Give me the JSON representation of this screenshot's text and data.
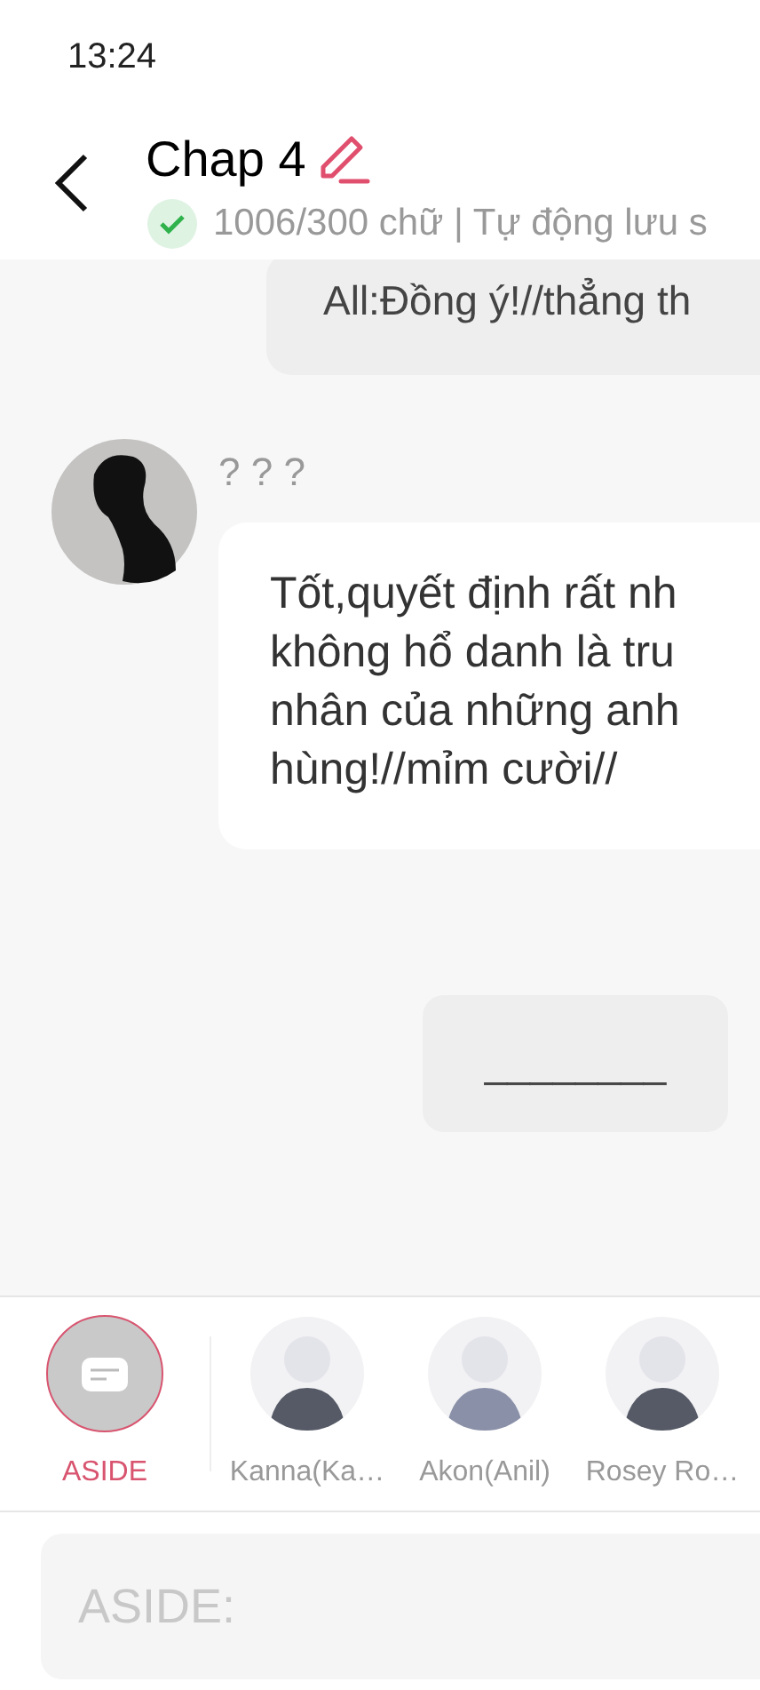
{
  "status_bar": {
    "time": "13:24"
  },
  "header": {
    "title": "Chap 4",
    "saved": true,
    "subtitle": "1006/300 chữ | Tự động lưu s"
  },
  "messages": [
    {
      "kind": "aside",
      "lines": [
        "All:Đồng ý!//thẳng th"
      ]
    },
    {
      "kind": "character",
      "name": "? ? ?",
      "lines": [
        "Tốt,quyết định rất nh",
        "không hổ danh là tru",
        "nhân của những anh",
        "hùng!//mỉm cười//"
      ]
    },
    {
      "kind": "aside",
      "lines": [
        "________"
      ]
    }
  ],
  "characters": [
    {
      "kind": "aside",
      "label": "ASIDE",
      "selected": true
    },
    {
      "kind": "character",
      "label": "Kanna(Ka…",
      "selected": false
    },
    {
      "kind": "character",
      "label": "Akon(Anil)",
      "selected": false
    },
    {
      "kind": "character",
      "label": "Rosey Ro…",
      "selected": false
    }
  ],
  "input": {
    "placeholder": "ASIDE:"
  }
}
